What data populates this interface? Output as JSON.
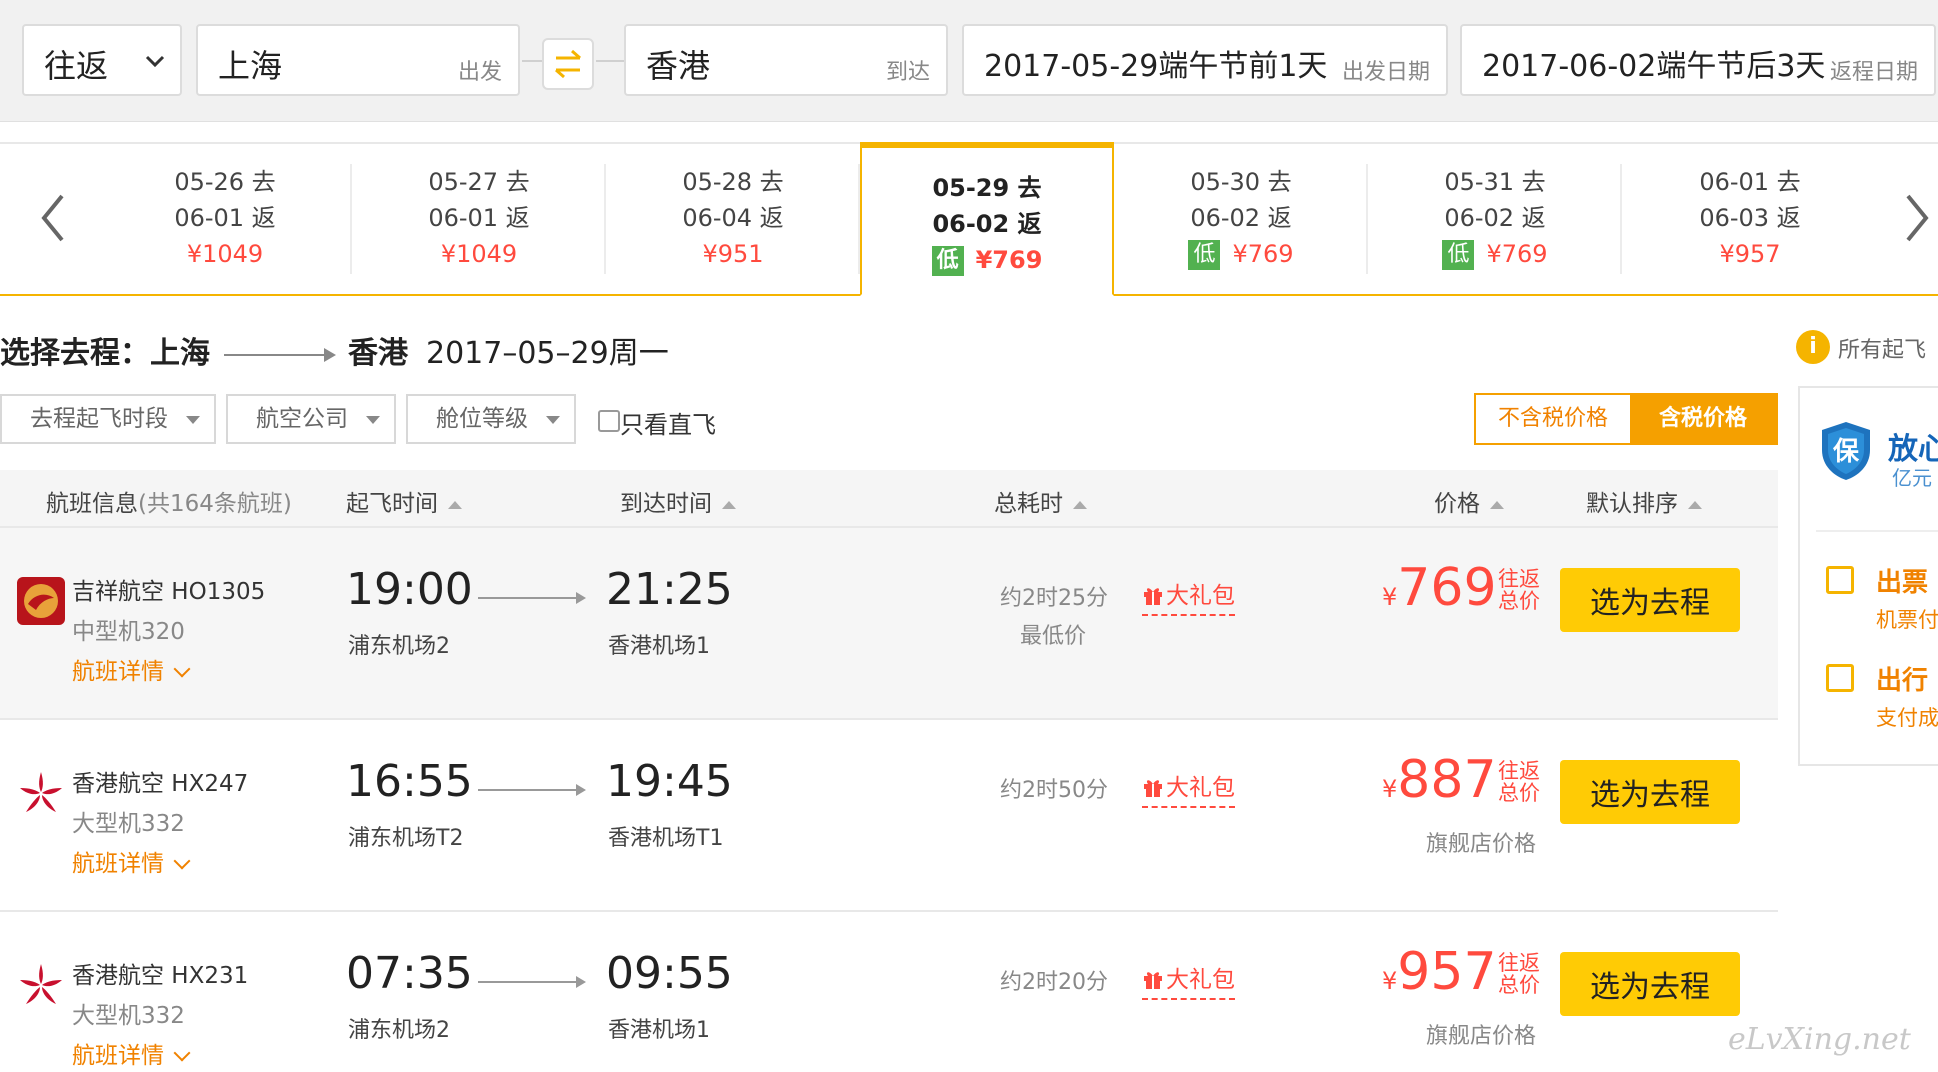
{
  "search": {
    "trip_type": "往返",
    "from_city": "上海",
    "from_hint": "出发",
    "to_city": "香港",
    "to_hint": "到达",
    "depart_date": "2017-05-29端午节前1天",
    "depart_hint": "出发日期",
    "return_date": "2017-06-02端午节后3天",
    "return_hint": "返程日期"
  },
  "date_strip": {
    "low_label": "低",
    "cells": [
      {
        "depart": "05-26 去",
        "return": "06-01 返",
        "price": "¥1049",
        "low": false,
        "active": false
      },
      {
        "depart": "05-27 去",
        "return": "06-01 返",
        "price": "¥1049",
        "low": false,
        "active": false
      },
      {
        "depart": "05-28 去",
        "return": "06-04 返",
        "price": "¥951",
        "low": false,
        "active": false
      },
      {
        "depart": "05-29 去",
        "return": "06-02 返",
        "price": "¥769",
        "low": true,
        "active": true
      },
      {
        "depart": "05-30 去",
        "return": "06-02 返",
        "price": "¥769",
        "low": true,
        "active": false
      },
      {
        "depart": "05-31 去",
        "return": "06-02 返",
        "price": "¥769",
        "low": true,
        "active": false
      },
      {
        "depart": "06-01 去",
        "return": "06-03 返",
        "price": "¥957",
        "low": false,
        "active": false
      }
    ]
  },
  "selection": {
    "prefix": "选择去程：上海",
    "destination": "香港",
    "date": "2017–05–29周一",
    "tip_icon": "i",
    "tip_text": "所有起飞"
  },
  "filters": {
    "time_period": "去程起飞时段",
    "airline": "航空公司",
    "cabin": "舱位等级",
    "direct_only": "只看直飞",
    "tax_excluded": "不含税价格",
    "tax_included": "含税价格"
  },
  "side_promo": {
    "brand": "放心",
    "brand_sub": "亿元",
    "item1_title": "出票",
    "item1_sub": "机票付",
    "item2_title": "出行",
    "item2_sub": "支付成"
  },
  "table_header": {
    "flight_info": "航班信息",
    "flight_count": "(共164条航班)",
    "depart_time": "起飞时间",
    "arrive_time": "到达时间",
    "duration": "总耗时",
    "price": "价格",
    "sort": "默认排序"
  },
  "flights": [
    {
      "airline": "吉祥航空 HO1305",
      "aircraft": "中型机320",
      "details": "航班详情",
      "depart_time": "19:00",
      "depart_airport": "浦东机场2",
      "arrive_time": "21:25",
      "arrive_airport": "香港机场1",
      "duration": "约2时25分",
      "note": "最低价",
      "gift": "大礼包",
      "currency": "¥",
      "price": "769",
      "price_tag": "往返总价",
      "shop_note": "",
      "button": "选为去程"
    },
    {
      "airline": "香港航空 HX247",
      "aircraft": "大型机332",
      "details": "航班详情",
      "depart_time": "16:55",
      "depart_airport": "浦东机场T2",
      "arrive_time": "19:45",
      "arrive_airport": "香港机场T1",
      "duration": "约2时50分",
      "note": "",
      "gift": "大礼包",
      "currency": "¥",
      "price": "887",
      "price_tag": "往返总价",
      "shop_note": "旗舰店价格",
      "button": "选为去程"
    },
    {
      "airline": "香港航空 HX231",
      "aircraft": "大型机332",
      "details": "航班详情",
      "depart_time": "07:35",
      "depart_airport": "浦东机场2",
      "arrive_time": "09:55",
      "arrive_airport": "香港机场1",
      "duration": "约2时20分",
      "note": "",
      "gift": "大礼包",
      "currency": "¥",
      "price": "957",
      "price_tag": "往返总价",
      "shop_note": "旗舰店价格",
      "button": "选为去程"
    }
  ],
  "watermark": "eLvXing.net",
  "colors": {
    "accent_yellow": "#ffcb05",
    "accent_orange": "#f08200",
    "price_red": "#ff4a3e",
    "low_green": "#52b150"
  }
}
